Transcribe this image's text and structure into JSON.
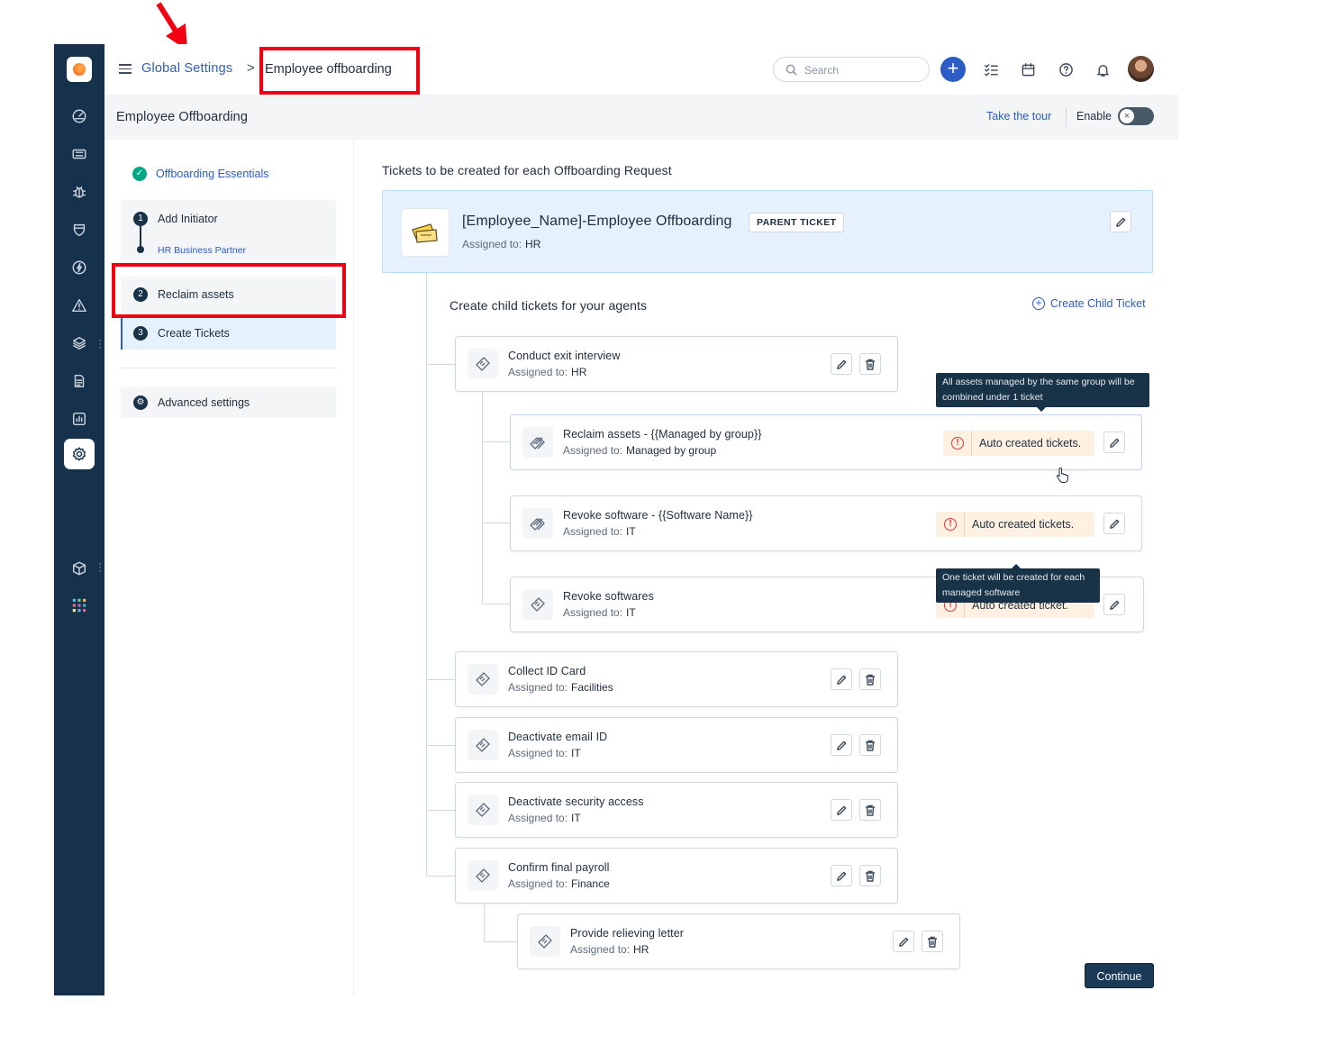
{
  "breadcrumb": {
    "parent": "Global Settings",
    "separator": ">",
    "current": "Employee offboarding"
  },
  "header": {
    "search_placeholder": "Search"
  },
  "subheader": {
    "title": "Employee Offboarding",
    "tour_link": "Take the tour",
    "enable_label": "Enable",
    "enable_state": "off",
    "toggle_glyph": "×"
  },
  "steps": {
    "essentials": "Offboarding Essentials",
    "items": [
      {
        "num": "1",
        "label": "Add Initiator",
        "sub": "HR Business Partner"
      },
      {
        "num": "2",
        "label": "Reclaim assets"
      },
      {
        "num": "3",
        "label": "Create Tickets"
      }
    ],
    "advanced": "Advanced settings"
  },
  "main": {
    "title": "Tickets to be created for each Offboarding Request",
    "parent_ticket": {
      "name": "[Employee_Name]-Employee Offboarding",
      "tag": "PARENT TICKET",
      "assigned_label": "Assigned to:",
      "assigned_to": "HR"
    },
    "child_heading": "Create child tickets for your agents",
    "create_child_label": "Create Child Ticket",
    "assigned_label": "Assigned to:",
    "tickets": [
      {
        "name": "Conduct exit interview",
        "assigned": "HR"
      },
      {
        "name": "Reclaim assets - {{Managed by group}}",
        "assigned": "Managed by group",
        "warning": "Auto created tickets."
      },
      {
        "name": "Revoke software - {{Software Name}}",
        "assigned": "IT",
        "warning": "Auto created tickets."
      },
      {
        "name": "Revoke softwares",
        "assigned": "IT",
        "warning": "Auto created ticket."
      },
      {
        "name": "Collect ID Card",
        "assigned": "Facilities"
      },
      {
        "name": "Deactivate email ID",
        "assigned": "IT"
      },
      {
        "name": "Deactivate security access",
        "assigned": "IT"
      },
      {
        "name": "Confirm final payroll",
        "assigned": "Finance"
      },
      {
        "name": "Provide relieving letter",
        "assigned": "HR"
      }
    ],
    "tooltips": {
      "group": [
        "All assets managed by the same group will be",
        "combined under 1 ticket"
      ],
      "software": [
        "One ticket will be created for each",
        "managed software"
      ]
    },
    "continue_label": "Continue"
  },
  "colors": {
    "rail": "#15314b",
    "accent": "#2c5cc5",
    "annotation_red": "#f00010",
    "warning_bg": "#fef1e1",
    "tooltip_bg": "#183247"
  },
  "icons": [
    "hamburger-icon",
    "search-icon",
    "plus-icon",
    "task-list-icon",
    "calendar-icon",
    "help-icon",
    "bell-icon",
    "ticket-icon",
    "tickets-stack-icon",
    "edit-icon",
    "trash-icon",
    "warning-icon",
    "check-icon",
    "arrow-annotation-icon",
    "pointer-cursor-icon"
  ]
}
